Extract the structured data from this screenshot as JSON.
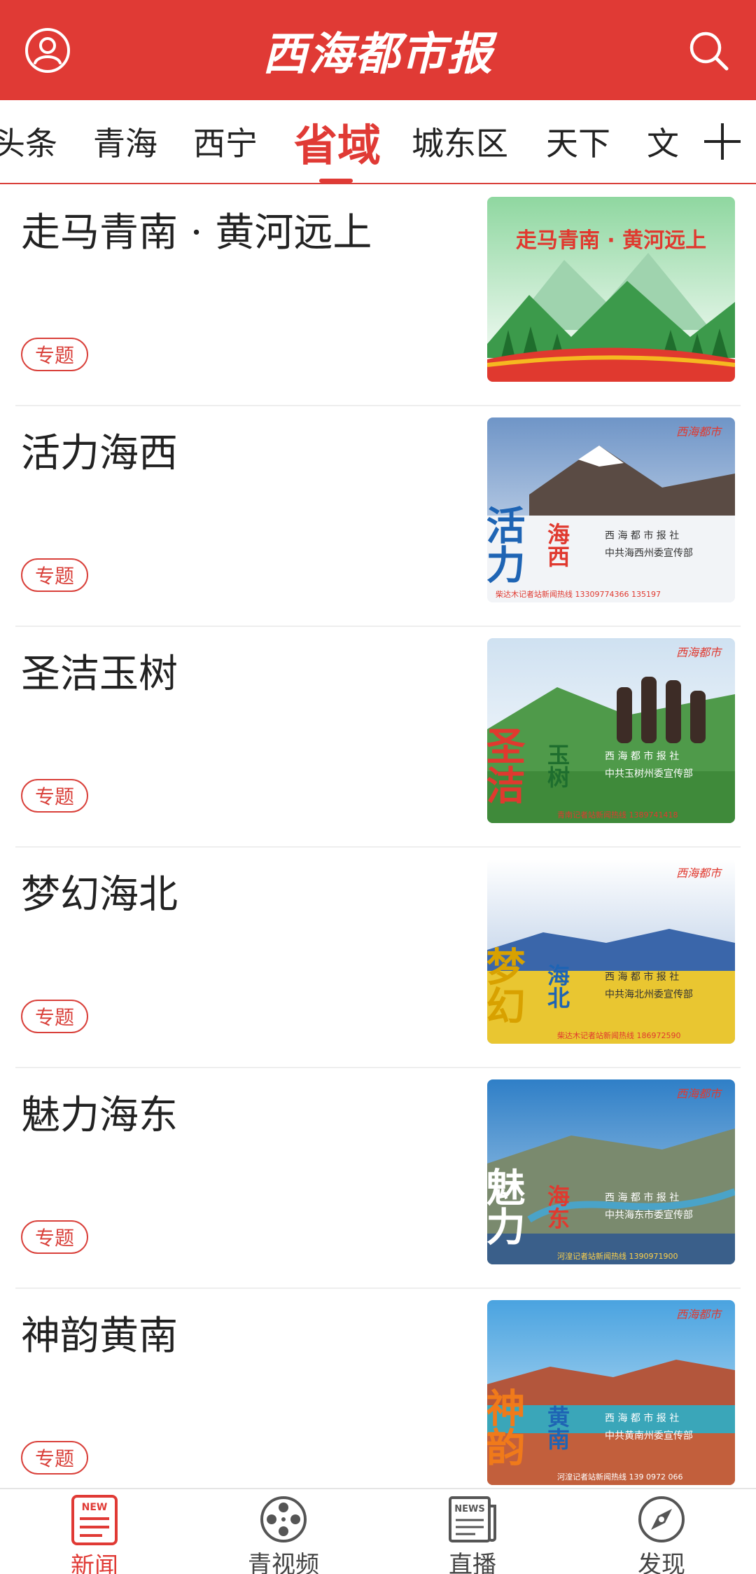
{
  "header": {
    "logo_text": "西海都市报",
    "user_icon": "user-circle-icon",
    "search_icon": "search-icon"
  },
  "tabs": {
    "items": [
      {
        "label": "头条"
      },
      {
        "label": "青海"
      },
      {
        "label": "西宁"
      },
      {
        "label": "省域"
      },
      {
        "label": "城东区"
      },
      {
        "label": "天下"
      },
      {
        "label": "文"
      }
    ],
    "active": "省域",
    "add_icon": "plus-icon"
  },
  "articles": [
    {
      "title": "走马青南 · 黄河远上",
      "badge": "专题",
      "image_title": "走马青南 · 黄河远上"
    },
    {
      "title": "活力海西",
      "badge": "专题",
      "image_big": "活力",
      "image_region": "海西",
      "image_org1": "西 海 都 市 报 社",
      "image_org2": "中共海西州委宣传部",
      "image_hotline": "柴达木记者站新闻热线 13309774366 135197"
    },
    {
      "title": "圣洁玉树",
      "badge": "专题",
      "image_big": "圣洁",
      "image_region": "玉树",
      "image_org1": "西 海 都 市 报 社",
      "image_org2": "中共玉树州委宣传部",
      "image_hotline": "青南记者站新闻热线 1389741418"
    },
    {
      "title": "梦幻海北",
      "badge": "专题",
      "image_big": "梦幻",
      "image_region": "海北",
      "image_org1": "西 海 都 市 报 社",
      "image_org2": "中共海北州委宣传部",
      "image_hotline": "柴达木记者站新闻热线 186972590"
    },
    {
      "title": "魅力海东",
      "badge": "专题",
      "image_big": "魅力",
      "image_region": "海东",
      "image_org1": "西 海 都 市 报 社",
      "image_org2": "中共海东市委宣传部",
      "image_hotline": "河湟记者站新闻热线 1390971900"
    },
    {
      "title": "神韵黄南",
      "badge": "专题",
      "image_big": "神韵",
      "image_region": "黄南",
      "image_org1": "西 海 都 市 报 社",
      "image_org2": "中共黄南州委宣传部",
      "image_hotline": "河湟记者站新闻热线 139 0972 066"
    }
  ],
  "image_logo": "西海都市",
  "bottom_nav": {
    "items": [
      {
        "label": "新闻",
        "icon": "news-icon",
        "active": true
      },
      {
        "label": "青视频",
        "icon": "film-reel-icon",
        "active": false
      },
      {
        "label": "直播",
        "icon": "newspaper-icon",
        "active": false
      },
      {
        "label": "发现",
        "icon": "compass-icon",
        "active": false
      }
    ]
  },
  "colors": {
    "brand_red": "#e03a35",
    "text": "#222222",
    "muted": "#444444"
  }
}
